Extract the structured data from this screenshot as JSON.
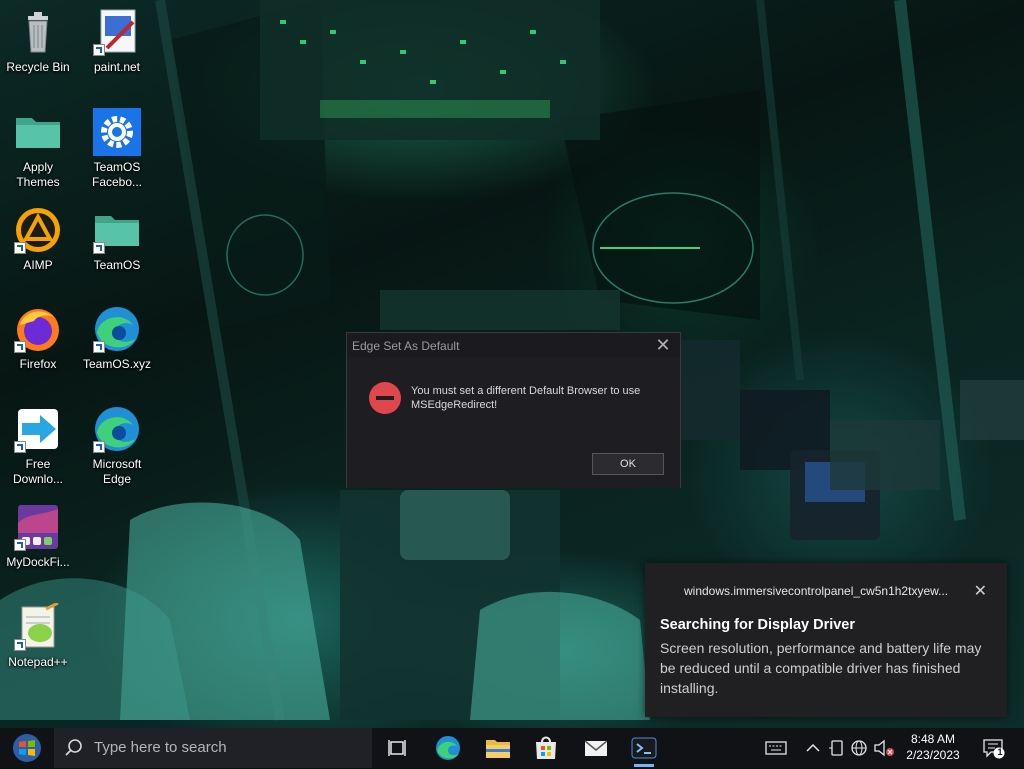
{
  "desktop": {
    "icons": [
      {
        "label": "Recycle Bin"
      },
      {
        "label": "paint.net"
      },
      {
        "label": "Apply Themes"
      },
      {
        "label": "TeamOS Facebo..."
      },
      {
        "label": "AIMP"
      },
      {
        "label": "TeamOS"
      },
      {
        "label": "Firefox"
      },
      {
        "label": "TeamOS.xyz"
      },
      {
        "label": "Free Downlo..."
      },
      {
        "label": "Microsoft Edge"
      },
      {
        "label": "MyDockFi..."
      },
      {
        "label": "Notepad++"
      }
    ]
  },
  "dialog": {
    "title": "Edge Set As Default",
    "message": "You must set a different Default Browser to use MSEdgeRedirect!",
    "ok_label": "OK",
    "icon": "error-icon"
  },
  "toast": {
    "app": "windows.immersivecontrolpanel_cw5n1h2txyew...",
    "heading": "Searching for Display Driver",
    "body": "Screen resolution, performance and battery life may be reduced until a compatible driver has finished installing."
  },
  "taskbar": {
    "search_placeholder": "Type here to search",
    "time": "8:48 AM",
    "date": "2/23/2023",
    "notification_count": "1",
    "apps": [
      "task-view",
      "edge",
      "file-explorer",
      "microsoft-store",
      "mail",
      "terminal"
    ]
  },
  "colors": {
    "taskbar": "#101216",
    "dialog_bg": "#1e1e22",
    "error_red": "#e0474c",
    "toast_bg": "#202022",
    "accent": "#74b4ff"
  }
}
